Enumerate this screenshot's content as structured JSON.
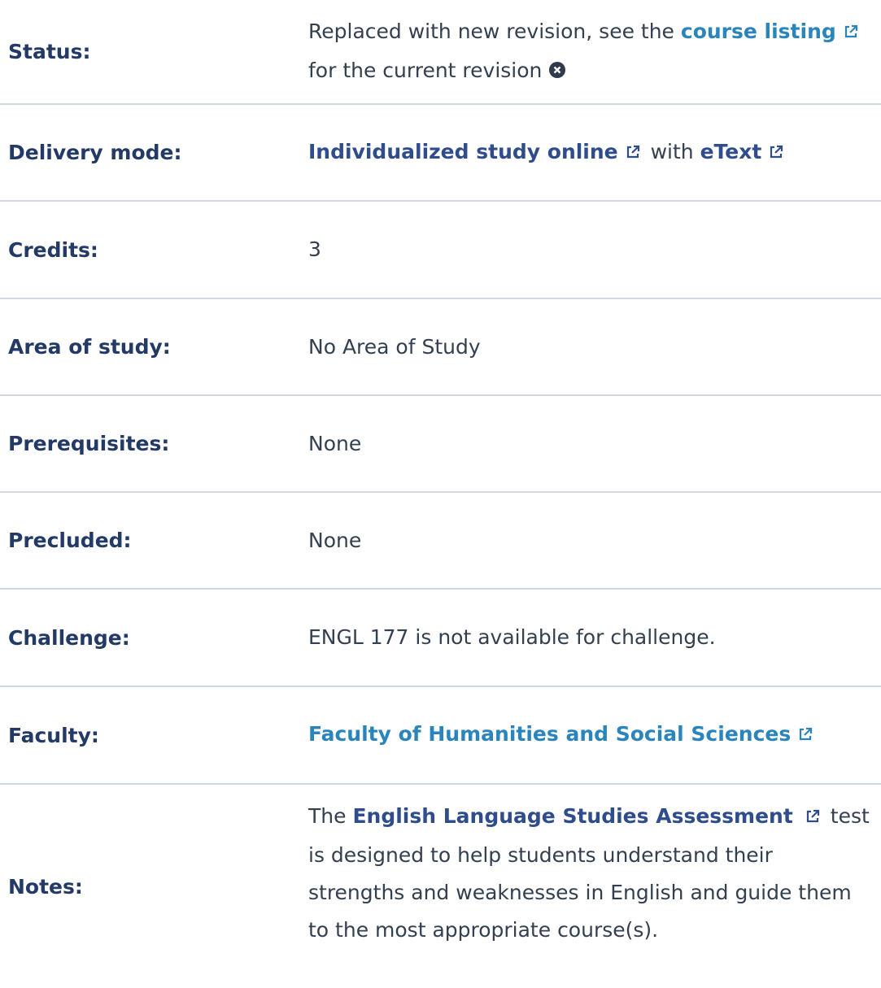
{
  "rows": [
    {
      "label": "Status:",
      "status": {
        "prefix": "Replaced with new revision, see the ",
        "link": "course listing",
        "suffix": " for the current revision"
      }
    },
    {
      "label": "Delivery mode:",
      "delivery": {
        "link1": "Individualized study online",
        "mid": " with ",
        "link2": "eText"
      }
    },
    {
      "label": "Credits:",
      "value": "3"
    },
    {
      "label": "Area of study:",
      "value": "No Area of Study"
    },
    {
      "label": "Prerequisites:",
      "value": "None"
    },
    {
      "label": "Precluded:",
      "value": "None"
    },
    {
      "label": "Challenge:",
      "value": "ENGL 177 is not available for challenge."
    },
    {
      "label": "Faculty:",
      "link": "Faculty of Humanities and Social Sciences"
    },
    {
      "label": "Notes:",
      "notes": {
        "prefix": "The ",
        "link": "English Language Studies Assessment",
        "text": "test is designed to help students understand their strengths and weaknesses in English and guide them to the most appropriate course(s)."
      }
    }
  ],
  "colors": {
    "label": "#243a66",
    "link_light": "#2b85bd",
    "link_navy": "#2f4d8c",
    "text": "#33404f",
    "divider": "#d3d9e2"
  },
  "icons": [
    "external-link-icon",
    "close-circle-icon"
  ]
}
